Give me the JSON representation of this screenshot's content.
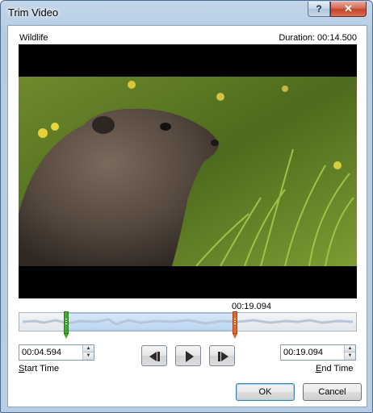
{
  "window": {
    "title": "Trim Video",
    "help_label": "?",
    "close_label": "✕"
  },
  "video": {
    "name": "Wildlife",
    "duration_text": "Duration: 00:14.500"
  },
  "timeline": {
    "marker_time": "00:19.094",
    "start_fraction": 0.14,
    "end_fraction": 0.64
  },
  "start_time": {
    "value": "00:04.594",
    "label_underlined": "S",
    "label_rest": "tart Time"
  },
  "end_time": {
    "value": "00:19.094",
    "label_underlined": "E",
    "label_rest": "nd Time"
  },
  "transport": {
    "previous_frame": "previous-frame-icon",
    "play": "play-icon",
    "next_frame": "next-frame-icon"
  },
  "buttons": {
    "ok": "OK",
    "cancel": "Cancel"
  },
  "colors": {
    "start_handle": "#3faa2c",
    "end_handle": "#e06a2e",
    "selection": "#bcd6f1"
  }
}
